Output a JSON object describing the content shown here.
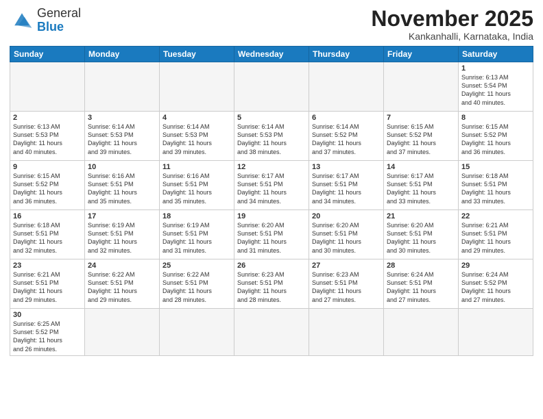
{
  "header": {
    "logo_general": "General",
    "logo_blue": "Blue",
    "month_title": "November 2025",
    "subtitle": "Kankanhalli, Karnataka, India"
  },
  "weekdays": [
    "Sunday",
    "Monday",
    "Tuesday",
    "Wednesday",
    "Thursday",
    "Friday",
    "Saturday"
  ],
  "weeks": [
    [
      {
        "day": "",
        "text": ""
      },
      {
        "day": "",
        "text": ""
      },
      {
        "day": "",
        "text": ""
      },
      {
        "day": "",
        "text": ""
      },
      {
        "day": "",
        "text": ""
      },
      {
        "day": "",
        "text": ""
      },
      {
        "day": "1",
        "text": "Sunrise: 6:13 AM\nSunset: 5:54 PM\nDaylight: 11 hours\nand 40 minutes."
      }
    ],
    [
      {
        "day": "2",
        "text": "Sunrise: 6:13 AM\nSunset: 5:53 PM\nDaylight: 11 hours\nand 40 minutes."
      },
      {
        "day": "3",
        "text": "Sunrise: 6:14 AM\nSunset: 5:53 PM\nDaylight: 11 hours\nand 39 minutes."
      },
      {
        "day": "4",
        "text": "Sunrise: 6:14 AM\nSunset: 5:53 PM\nDaylight: 11 hours\nand 39 minutes."
      },
      {
        "day": "5",
        "text": "Sunrise: 6:14 AM\nSunset: 5:53 PM\nDaylight: 11 hours\nand 38 minutes."
      },
      {
        "day": "6",
        "text": "Sunrise: 6:14 AM\nSunset: 5:52 PM\nDaylight: 11 hours\nand 37 minutes."
      },
      {
        "day": "7",
        "text": "Sunrise: 6:15 AM\nSunset: 5:52 PM\nDaylight: 11 hours\nand 37 minutes."
      },
      {
        "day": "8",
        "text": "Sunrise: 6:15 AM\nSunset: 5:52 PM\nDaylight: 11 hours\nand 36 minutes."
      }
    ],
    [
      {
        "day": "9",
        "text": "Sunrise: 6:15 AM\nSunset: 5:52 PM\nDaylight: 11 hours\nand 36 minutes."
      },
      {
        "day": "10",
        "text": "Sunrise: 6:16 AM\nSunset: 5:51 PM\nDaylight: 11 hours\nand 35 minutes."
      },
      {
        "day": "11",
        "text": "Sunrise: 6:16 AM\nSunset: 5:51 PM\nDaylight: 11 hours\nand 35 minutes."
      },
      {
        "day": "12",
        "text": "Sunrise: 6:17 AM\nSunset: 5:51 PM\nDaylight: 11 hours\nand 34 minutes."
      },
      {
        "day": "13",
        "text": "Sunrise: 6:17 AM\nSunset: 5:51 PM\nDaylight: 11 hours\nand 34 minutes."
      },
      {
        "day": "14",
        "text": "Sunrise: 6:17 AM\nSunset: 5:51 PM\nDaylight: 11 hours\nand 33 minutes."
      },
      {
        "day": "15",
        "text": "Sunrise: 6:18 AM\nSunset: 5:51 PM\nDaylight: 11 hours\nand 33 minutes."
      }
    ],
    [
      {
        "day": "16",
        "text": "Sunrise: 6:18 AM\nSunset: 5:51 PM\nDaylight: 11 hours\nand 32 minutes."
      },
      {
        "day": "17",
        "text": "Sunrise: 6:19 AM\nSunset: 5:51 PM\nDaylight: 11 hours\nand 32 minutes."
      },
      {
        "day": "18",
        "text": "Sunrise: 6:19 AM\nSunset: 5:51 PM\nDaylight: 11 hours\nand 31 minutes."
      },
      {
        "day": "19",
        "text": "Sunrise: 6:20 AM\nSunset: 5:51 PM\nDaylight: 11 hours\nand 31 minutes."
      },
      {
        "day": "20",
        "text": "Sunrise: 6:20 AM\nSunset: 5:51 PM\nDaylight: 11 hours\nand 30 minutes."
      },
      {
        "day": "21",
        "text": "Sunrise: 6:20 AM\nSunset: 5:51 PM\nDaylight: 11 hours\nand 30 minutes."
      },
      {
        "day": "22",
        "text": "Sunrise: 6:21 AM\nSunset: 5:51 PM\nDaylight: 11 hours\nand 29 minutes."
      }
    ],
    [
      {
        "day": "23",
        "text": "Sunrise: 6:21 AM\nSunset: 5:51 PM\nDaylight: 11 hours\nand 29 minutes."
      },
      {
        "day": "24",
        "text": "Sunrise: 6:22 AM\nSunset: 5:51 PM\nDaylight: 11 hours\nand 29 minutes."
      },
      {
        "day": "25",
        "text": "Sunrise: 6:22 AM\nSunset: 5:51 PM\nDaylight: 11 hours\nand 28 minutes."
      },
      {
        "day": "26",
        "text": "Sunrise: 6:23 AM\nSunset: 5:51 PM\nDaylight: 11 hours\nand 28 minutes."
      },
      {
        "day": "27",
        "text": "Sunrise: 6:23 AM\nSunset: 5:51 PM\nDaylight: 11 hours\nand 27 minutes."
      },
      {
        "day": "28",
        "text": "Sunrise: 6:24 AM\nSunset: 5:51 PM\nDaylight: 11 hours\nand 27 minutes."
      },
      {
        "day": "29",
        "text": "Sunrise: 6:24 AM\nSunset: 5:52 PM\nDaylight: 11 hours\nand 27 minutes."
      }
    ],
    [
      {
        "day": "30",
        "text": "Sunrise: 6:25 AM\nSunset: 5:52 PM\nDaylight: 11 hours\nand 26 minutes."
      },
      {
        "day": "",
        "text": ""
      },
      {
        "day": "",
        "text": ""
      },
      {
        "day": "",
        "text": ""
      },
      {
        "day": "",
        "text": ""
      },
      {
        "day": "",
        "text": ""
      },
      {
        "day": "",
        "text": ""
      }
    ]
  ]
}
